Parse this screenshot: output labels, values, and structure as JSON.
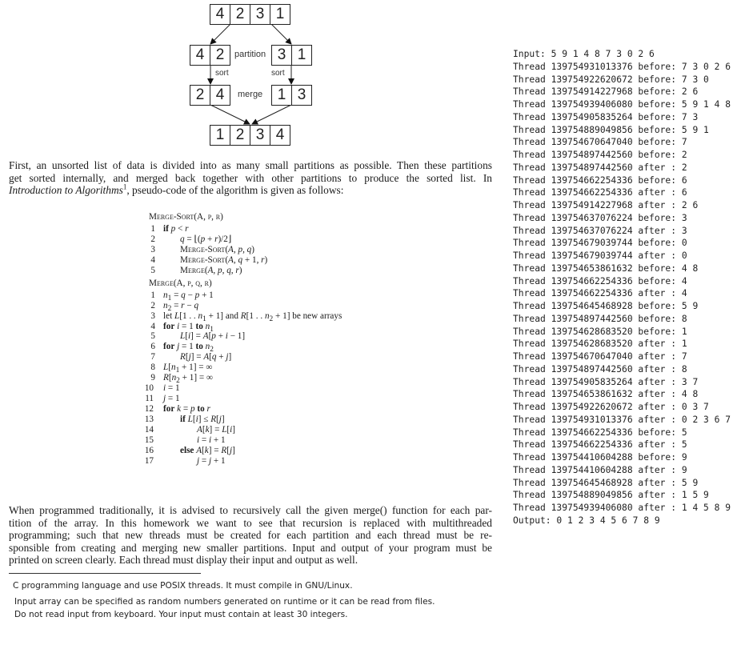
{
  "diagram": {
    "top_array": [
      "4",
      "2",
      "3",
      "1"
    ],
    "left_partition": [
      "4",
      "2"
    ],
    "right_partition": [
      "3",
      "1"
    ],
    "left_sorted": [
      "2",
      "4"
    ],
    "right_sorted": [
      "1",
      "3"
    ],
    "result_array": [
      "1",
      "2",
      "3",
      "4"
    ],
    "labels": {
      "partition": "partition",
      "sort_left": "sort",
      "sort_right": "sort",
      "merge": "merge"
    }
  },
  "intro_paragraph": {
    "lines": [
      "First, an unsorted list of data is divided into as many small partitions as possible. Then these partitions",
      "get sorted internally, and merged back together with other partitions to produce the sorted list. In"
    ],
    "line3_italic": "Introduction to Algorithms",
    "line3_sup": "1",
    "line3_rest": ", pseudo-code of the algorithm is given as follows:"
  },
  "pseudocode": {
    "merge_sort_header": "Merge-Sort(A, p, r)",
    "merge_sort_lines": [
      {
        "n": "1",
        "html": "<span class=\"kw\">if</span> <span class=\"it\">p</span> &lt; <span class=\"it\">r</span>",
        "indent": 0
      },
      {
        "n": "2",
        "html": "<span class=\"it\">q</span> = &lfloor;(<span class=\"it\">p</span> + <span class=\"it\">r</span>)/2&rfloor;",
        "indent": 1
      },
      {
        "n": "3",
        "html": "<span class=\"sc\">Merge-Sort</span>(<span class=\"it\">A, p, q</span>)",
        "indent": 1
      },
      {
        "n": "4",
        "html": "<span class=\"sc\">Merge-Sort</span>(<span class=\"it\">A, q</span> + 1, <span class=\"it\">r</span>)",
        "indent": 1
      },
      {
        "n": "5",
        "html": "<span class=\"sc\">Merge</span>(<span class=\"it\">A, p, q, r</span>)",
        "indent": 1
      }
    ],
    "merge_header": "Merge(A, p, q, r)",
    "merge_lines": [
      {
        "n": "1",
        "html": "<span class=\"it\">n</span><sub>1</sub> = <span class=\"it\">q</span> &minus; <span class=\"it\">p</span> + 1",
        "indent": 0
      },
      {
        "n": "2",
        "html": "<span class=\"it\">n</span><sub>2</sub> = <span class=\"it\">r</span> &minus; <span class=\"it\">q</span>",
        "indent": 0
      },
      {
        "n": "3",
        "html": "let <span class=\"it\">L</span>[1 . . <span class=\"it\">n</span><sub>1</sub> + 1] and <span class=\"it\">R</span>[1 . . <span class=\"it\">n</span><sub>2</sub> + 1] be new arrays",
        "indent": 0
      },
      {
        "n": "4",
        "html": "<span class=\"kw\">for</span> <span class=\"it\">i</span> = 1 <span class=\"kw\">to</span> <span class=\"it\">n</span><sub>1</sub>",
        "indent": 0
      },
      {
        "n": "5",
        "html": "<span class=\"it\">L</span>[<span class=\"it\">i</span>] = <span class=\"it\">A</span>[<span class=\"it\">p</span> + <span class=\"it\">i</span> &minus; 1]",
        "indent": 1
      },
      {
        "n": "6",
        "html": "<span class=\"kw\">for</span> <span class=\"it\">j</span> = 1 <span class=\"kw\">to</span> <span class=\"it\">n</span><sub>2</sub>",
        "indent": 0
      },
      {
        "n": "7",
        "html": "<span class=\"it\">R</span>[<span class=\"it\">j</span>] = <span class=\"it\">A</span>[<span class=\"it\">q</span> + <span class=\"it\">j</span>]",
        "indent": 1
      },
      {
        "n": "8",
        "html": "<span class=\"it\">L</span>[<span class=\"it\">n</span><sub>1</sub> + 1] = &infin;",
        "indent": 0
      },
      {
        "n": "9",
        "html": "<span class=\"it\">R</span>[<span class=\"it\">n</span><sub>2</sub> + 1] = &infin;",
        "indent": 0
      },
      {
        "n": "10",
        "html": "<span class=\"it\">i</span> = 1",
        "indent": 0
      },
      {
        "n": "11",
        "html": "<span class=\"it\">j</span> = 1",
        "indent": 0
      },
      {
        "n": "12",
        "html": "<span class=\"kw\">for</span> <span class=\"it\">k</span> = <span class=\"it\">p</span> <span class=\"kw\">to</span> <span class=\"it\">r</span>",
        "indent": 0
      },
      {
        "n": "13",
        "html": "<span class=\"kw\">if</span> <span class=\"it\">L</span>[<span class=\"it\">i</span>] &le; <span class=\"it\">R</span>[<span class=\"it\">j</span>]",
        "indent": 1
      },
      {
        "n": "14",
        "html": "<span class=\"it\">A</span>[<span class=\"it\">k</span>] = <span class=\"it\">L</span>[<span class=\"it\">i</span>]",
        "indent": 2
      },
      {
        "n": "15",
        "html": "<span class=\"it\">i</span> = <span class=\"it\">i</span> + 1",
        "indent": 2
      },
      {
        "n": "16",
        "html": "<span class=\"kw\">else</span> <span class=\"it\">A</span>[<span class=\"it\">k</span>] = <span class=\"it\">R</span>[<span class=\"it\">j</span>]",
        "indent": 1
      },
      {
        "n": "17",
        "html": "<span class=\"it\">j</span> = <span class=\"it\">j</span> + 1",
        "indent": 2
      }
    ]
  },
  "homework_paragraph": {
    "lines": [
      "When programmed traditionally, it is advised to recursively call the given merge() function for each par-",
      "tition of the array.  In this homework we want to see that recursion is replaced with multithreaded",
      "programming; such that new threads must be created for each partition and each thread must be re-",
      "sponsible from creating and merging new smaller partitions. Input and output of your program must be",
      "printed on screen clearly. Each thread must display their input and output as well."
    ]
  },
  "footnotes": [
    "C programming language and use POSIX threads. It must compile in GNU/Linux.",
    "Input array can be specified as random numbers generated on runtime or it can be read from files.",
    "Do not read input from keyboard. Your input must contain at least 30 integers."
  ],
  "terminal_output": [
    "Input: 5 9 1 4 8 7 3 0 2 6",
    "Thread 139754931013376 before: 7 3 0 2 6",
    "Thread 139754922620672 before: 7 3 0",
    "Thread 139754914227968 before: 2 6",
    "Thread 139754939406080 before: 5 9 1 4 8",
    "Thread 139754905835264 before: 7 3",
    "Thread 139754889049856 before: 5 9 1",
    "Thread 139754670647040 before: 7",
    "Thread 139754897442560 before: 2",
    "Thread 139754897442560 after : 2",
    "Thread 139754662254336 before: 6",
    "Thread 139754662254336 after : 6",
    "Thread 139754914227968 after : 2 6",
    "Thread 139754637076224 before: 3",
    "Thread 139754637076224 after : 3",
    "Thread 139754679039744 before: 0",
    "Thread 139754679039744 after : 0",
    "Thread 139754653861632 before: 4 8",
    "Thread 139754662254336 before: 4",
    "Thread 139754662254336 after : 4",
    "Thread 139754645468928 before: 5 9",
    "Thread 139754897442560 before: 8",
    "Thread 139754628683520 before: 1",
    "Thread 139754628683520 after : 1",
    "Thread 139754670647040 after : 7",
    "Thread 139754897442560 after : 8",
    "Thread 139754905835264 after : 3 7",
    "Thread 139754653861632 after : 4 8",
    "Thread 139754922620672 after : 0 3 7",
    "Thread 139754931013376 after : 0 2 3 6 7",
    "Thread 139754662254336 before: 5",
    "Thread 139754662254336 after : 5",
    "Thread 139754410604288 before: 9",
    "Thread 139754410604288 after : 9",
    "Thread 139754645468928 after : 5 9",
    "Thread 139754889049856 after : 1 5 9",
    "Thread 139754939406080 after : 1 4 5 8 9",
    "Output: 0 1 2 3 4 5 6 7 8 9"
  ]
}
